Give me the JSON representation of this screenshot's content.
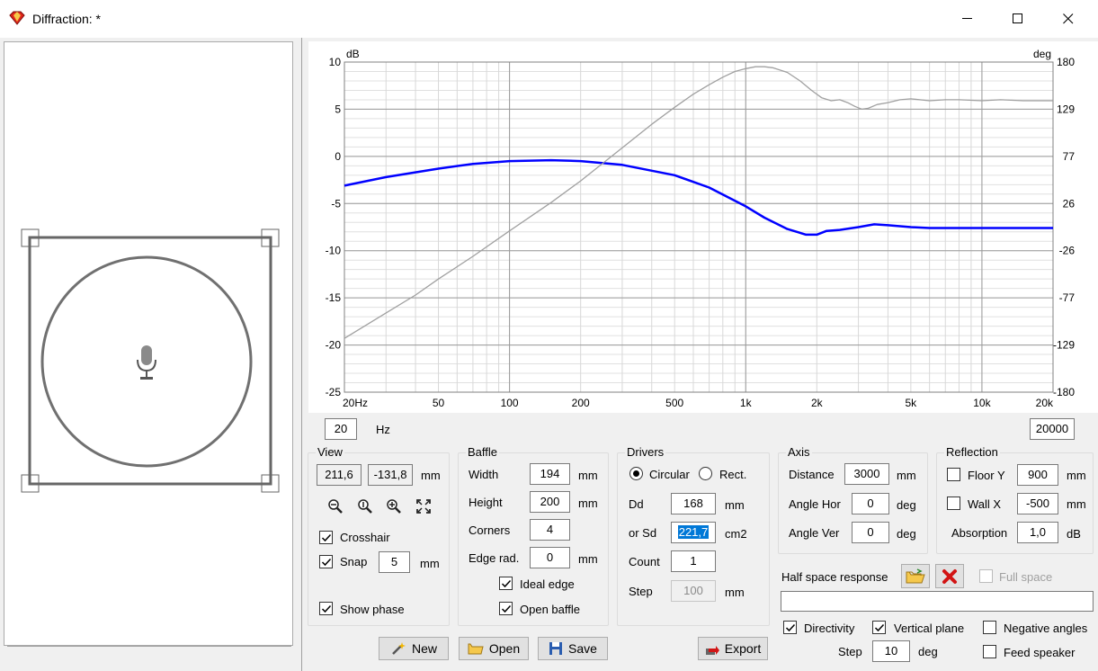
{
  "window": {
    "title": "Diffraction: *"
  },
  "chart_data": {
    "type": "line",
    "x_scale": "log",
    "xlim": [
      20,
      20000
    ],
    "ylim": [
      -25,
      10
    ],
    "ylabel": "dB",
    "y2label": "deg",
    "y2lim": [
      -180,
      180
    ],
    "x_ticks": [
      "20Hz",
      "50",
      "100",
      "200",
      "500",
      "1k",
      "2k",
      "5k",
      "10k",
      "20k"
    ],
    "x_tick_values": [
      20,
      50,
      100,
      200,
      500,
      1000,
      2000,
      5000,
      10000,
      20000
    ],
    "y_ticks": [
      "10",
      "5",
      "0",
      "-5",
      "-10",
      "-15",
      "-20",
      "-25"
    ],
    "y_tick_values": [
      10,
      5,
      0,
      -5,
      -10,
      -15,
      -20,
      -25
    ],
    "y2_ticks": [
      "180",
      "129",
      "77",
      "26",
      "-26",
      "-77",
      "-129",
      "-180"
    ],
    "grid": true,
    "colors": {
      "magnitude": "#0000ff",
      "phase": "#a0a0a0"
    },
    "series": [
      {
        "values_x": [
          20,
          30,
          40,
          50,
          70,
          100,
          150,
          200,
          300,
          400,
          500,
          600,
          700,
          800,
          900,
          1000,
          1100,
          1200,
          1300,
          1500,
          1700,
          1900,
          2100,
          2300,
          2500,
          2700,
          2900,
          3100,
          3300,
          3600,
          4000,
          4500,
          5000,
          6000,
          7000,
          8000,
          10000,
          12000,
          15000,
          20000
        ],
        "values_y": [
          -19.3,
          -16.6,
          -14.7,
          -13.0,
          -10.6,
          -7.9,
          -4.9,
          -2.6,
          0.9,
          3.4,
          5.2,
          6.6,
          7.6,
          8.4,
          9.0,
          9.3,
          9.5,
          9.5,
          9.4,
          8.9,
          8.0,
          7.0,
          6.2,
          5.9,
          6.0,
          5.7,
          5.3,
          5.0,
          5.1,
          5.5,
          5.7,
          6.0,
          6.1,
          5.9,
          6.0,
          6.0,
          5.9,
          6.0,
          5.9,
          5.9
        ]
      },
      {
        "values_x": [
          20,
          30,
          50,
          70,
          100,
          150,
          200,
          300,
          500,
          700,
          1000,
          1200,
          1500,
          1800,
          2000,
          2200,
          2500,
          3000,
          3500,
          4000,
          5000,
          6000,
          8000,
          10000,
          15000,
          20000
        ],
        "values_y": [
          -3.1,
          -2.2,
          -1.3,
          -0.8,
          -0.5,
          -0.4,
          -0.5,
          -0.9,
          -2.0,
          -3.3,
          -5.3,
          -6.5,
          -7.7,
          -8.3,
          -8.3,
          -7.9,
          -7.8,
          -7.5,
          -7.2,
          -7.3,
          -7.5,
          -7.6,
          -7.6,
          -7.6,
          -7.6,
          -7.6
        ]
      }
    ]
  },
  "freq_range": {
    "min": "20",
    "min_unit": "Hz",
    "max": "20000"
  },
  "view": {
    "title": "View",
    "x": "211,6",
    "y": "-131,8",
    "unit": "mm",
    "crosshair": "Crosshair",
    "snap": "Snap",
    "snap_value": "5",
    "snap_unit": "mm",
    "show_phase": "Show phase"
  },
  "baffle": {
    "title": "Baffle",
    "width_label": "Width",
    "width": "194",
    "width_unit": "mm",
    "height_label": "Height",
    "height": "200",
    "height_unit": "mm",
    "corners_label": "Corners",
    "corners": "4",
    "edge_label": "Edge rad.",
    "edge": "0",
    "edge_unit": "mm",
    "ideal_edge": "Ideal edge",
    "open_baffle": "Open baffle"
  },
  "drivers": {
    "title": "Drivers",
    "circular": "Circular",
    "rect": "Rect.",
    "dd_label": "Dd",
    "dd": "168",
    "dd_unit": "mm",
    "sd_label": "or Sd",
    "sd": "221,7",
    "sd_unit": "cm2",
    "count_label": "Count",
    "count": "1",
    "step_label": "Step",
    "step": "100",
    "step_unit": "mm"
  },
  "axis": {
    "title": "Axis",
    "distance_label": "Distance",
    "distance": "3000",
    "distance_unit": "mm",
    "hor_label": "Angle Hor",
    "hor": "0",
    "hor_unit": "deg",
    "ver_label": "Angle Ver",
    "ver": "0",
    "ver_unit": "deg"
  },
  "reflection": {
    "title": "Reflection",
    "floor_label": "Floor Y",
    "floor": "900",
    "floor_unit": "mm",
    "wall_label": "Wall  X",
    "wall": "-500",
    "wall_unit": "mm",
    "absorption_label": "Absorption",
    "absorption": "1,0",
    "absorption_unit": "dB"
  },
  "half_space": {
    "label": "Half space response",
    "full_space": "Full space"
  },
  "bottom": {
    "directivity": "Directivity",
    "vertical_plane": "Vertical plane",
    "negative_angles": "Negative angles",
    "step_label": "Step",
    "step": "10",
    "step_unit": "deg",
    "feed_speaker": "Feed speaker"
  },
  "buttons": {
    "new": "New",
    "open": "Open",
    "save": "Save",
    "export": "Export"
  }
}
